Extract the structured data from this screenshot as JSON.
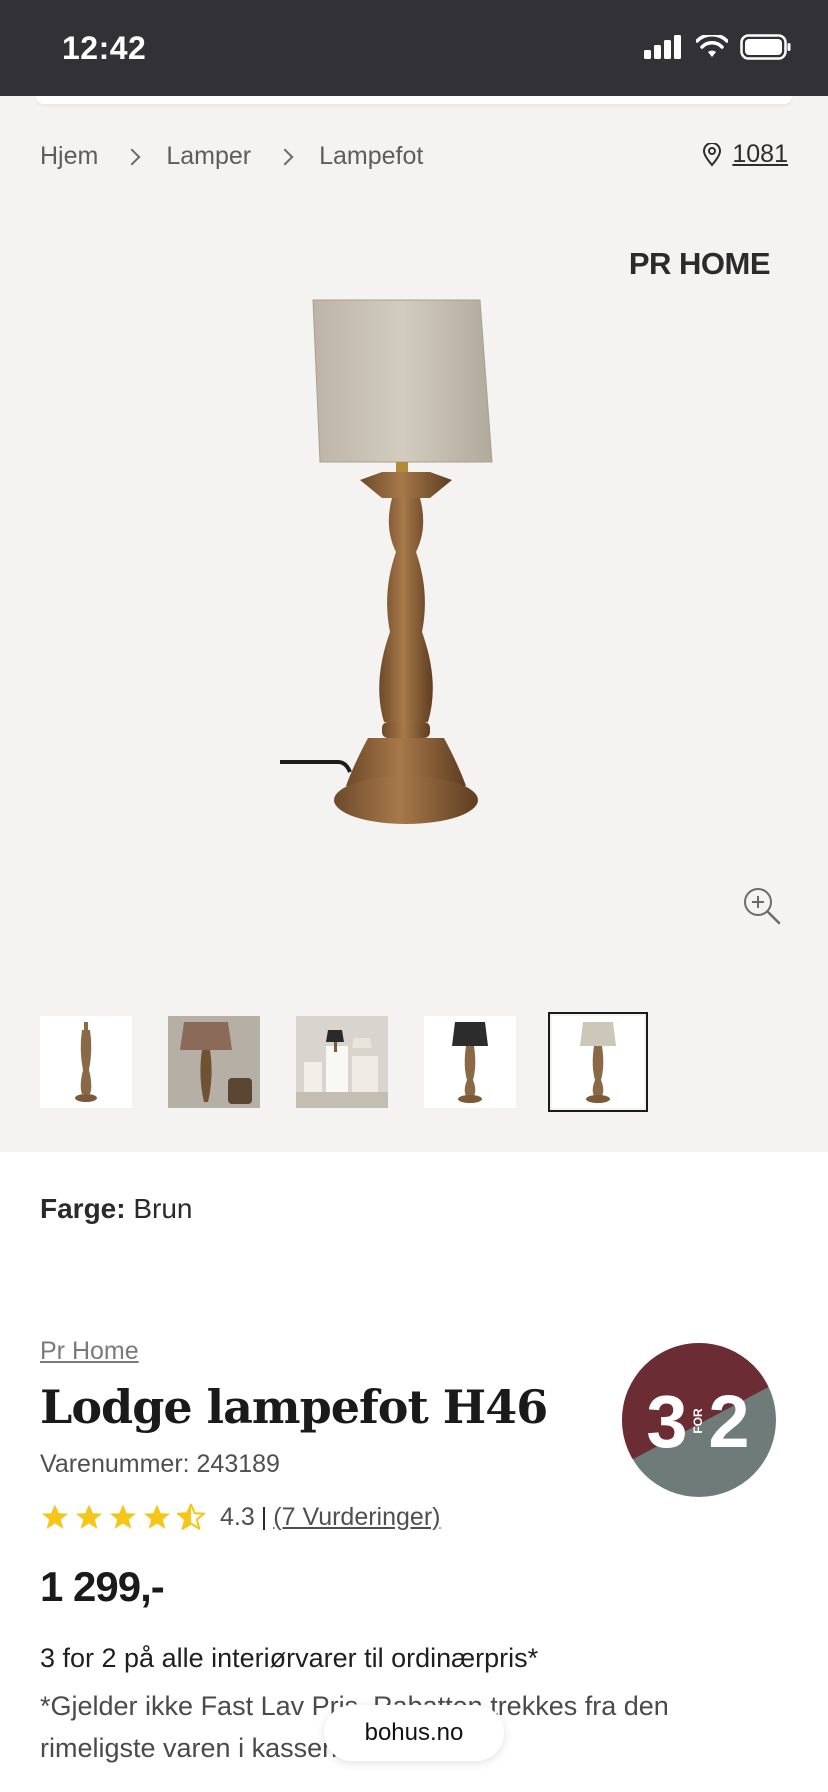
{
  "status_bar": {
    "time": "12:42"
  },
  "breadcrumb": {
    "items": [
      "Hjem",
      "Lamper",
      "Lampefot"
    ]
  },
  "store": {
    "code": "1081",
    "icon": "location-pin-icon"
  },
  "brand_logo": "PR HOME",
  "gallery": {
    "thumbnail_count": 5,
    "active_thumbnail": 5
  },
  "product": {
    "color_label": "Farge:",
    "color_value": "Brun",
    "brand": "Pr Home",
    "title": "Lodge lampefot H46",
    "sku": "Varenummer: 243189",
    "rating_value": "4.3",
    "rating_stars": 4.3,
    "rating_pipe": "|",
    "reviews": "(7 Vurderinger)",
    "price": "1 299,-"
  },
  "badge": {
    "left": "3",
    "middle": "FOR",
    "right": "2",
    "top_color": "#6b2c34",
    "bottom_color": "#6f7b79"
  },
  "promo": {
    "title": "3 for 2 på alle interiørvarer til ordinærpris*",
    "description": "*Gjelder ikke Fast Lav Pris. Rabatten trekkes fra den rimeligste varen i kassen."
  },
  "site_pill": "bohus.no",
  "colors": {
    "status_bar": "#323236",
    "gallery_bg": "#f5f3f1",
    "star": "#f5c518"
  }
}
